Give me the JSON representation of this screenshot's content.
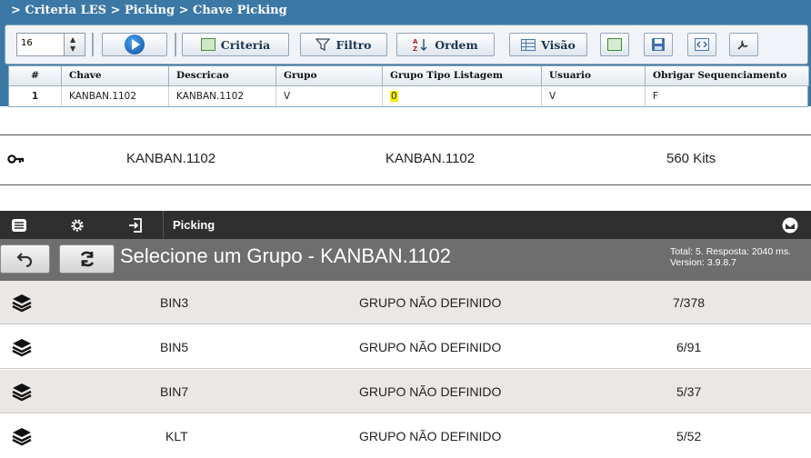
{
  "panel1": {
    "breadcrumb": "> Criteria LES > Picking > Chave Picking",
    "page_size": "16",
    "buttons": {
      "criteria": "Criteria",
      "filtro": "Filtro",
      "ordem": "Ordem",
      "visao": "Visão"
    },
    "table": {
      "headers": [
        "#",
        "Chave",
        "Descricao",
        "Grupo",
        "Grupo Tipo Listagem",
        "Usuario",
        "Obrigar Sequenciamento"
      ],
      "rows": [
        [
          "1",
          "KANBAN.1102",
          "KANBAN.1102",
          "V",
          "0",
          "V",
          "F"
        ]
      ]
    }
  },
  "panel2": {
    "icon": "key-icon",
    "chave": "KANBAN.1102",
    "descricao": "KANBAN.1102",
    "kits": "560 Kits"
  },
  "panel3": {
    "topbar": {
      "title": "Picking",
      "icons": [
        "menu-icon",
        "gear-icon",
        "login-icon",
        "mail-icon"
      ]
    },
    "heading": "Selecione um Grupo - KANBAN.1102",
    "info": {
      "line1": "Total: 5. Resposta: 2040 ms.",
      "line2": "Version: 3.9.8.7"
    },
    "rows": [
      {
        "name": "BIN3",
        "group": "GRUPO NÃO DEFINIDO",
        "count": "7/378"
      },
      {
        "name": "BIN5",
        "group": "GRUPO NÃO DEFINIDO",
        "count": "6/91"
      },
      {
        "name": "BIN7",
        "group": "GRUPO NÃO DEFINIDO",
        "count": "5/37"
      },
      {
        "name": "KLT",
        "group": "GRUPO NÃO DEFINIDO",
        "count": "5/52"
      }
    ],
    "colors": {
      "row_odd": "#ebe7e4",
      "row_even": "#ffffff",
      "topbar": "#2f2f2f",
      "bar": "#6e6e6e"
    }
  }
}
